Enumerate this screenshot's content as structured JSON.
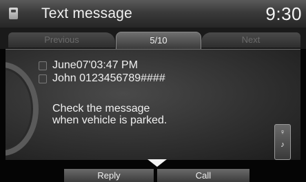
{
  "header": {
    "title": "Text message",
    "clock": "9:30",
    "icon": "phone-icon"
  },
  "tabs": {
    "previous": "Previous",
    "page": "5/10",
    "next": "Next"
  },
  "message": {
    "date_time": "June07'03:47 PM",
    "sender": "John 0123456789####",
    "body_line1": "Check the message",
    "body_line2": "when vehicle is parked."
  },
  "side_button": {
    "icon_top": "voice-icon",
    "icon_bottom": "speaker-mute-icon",
    "glyph_top": "♀",
    "glyph_bottom": "♪"
  },
  "footer": {
    "reply": "Reply",
    "call": "Call"
  }
}
